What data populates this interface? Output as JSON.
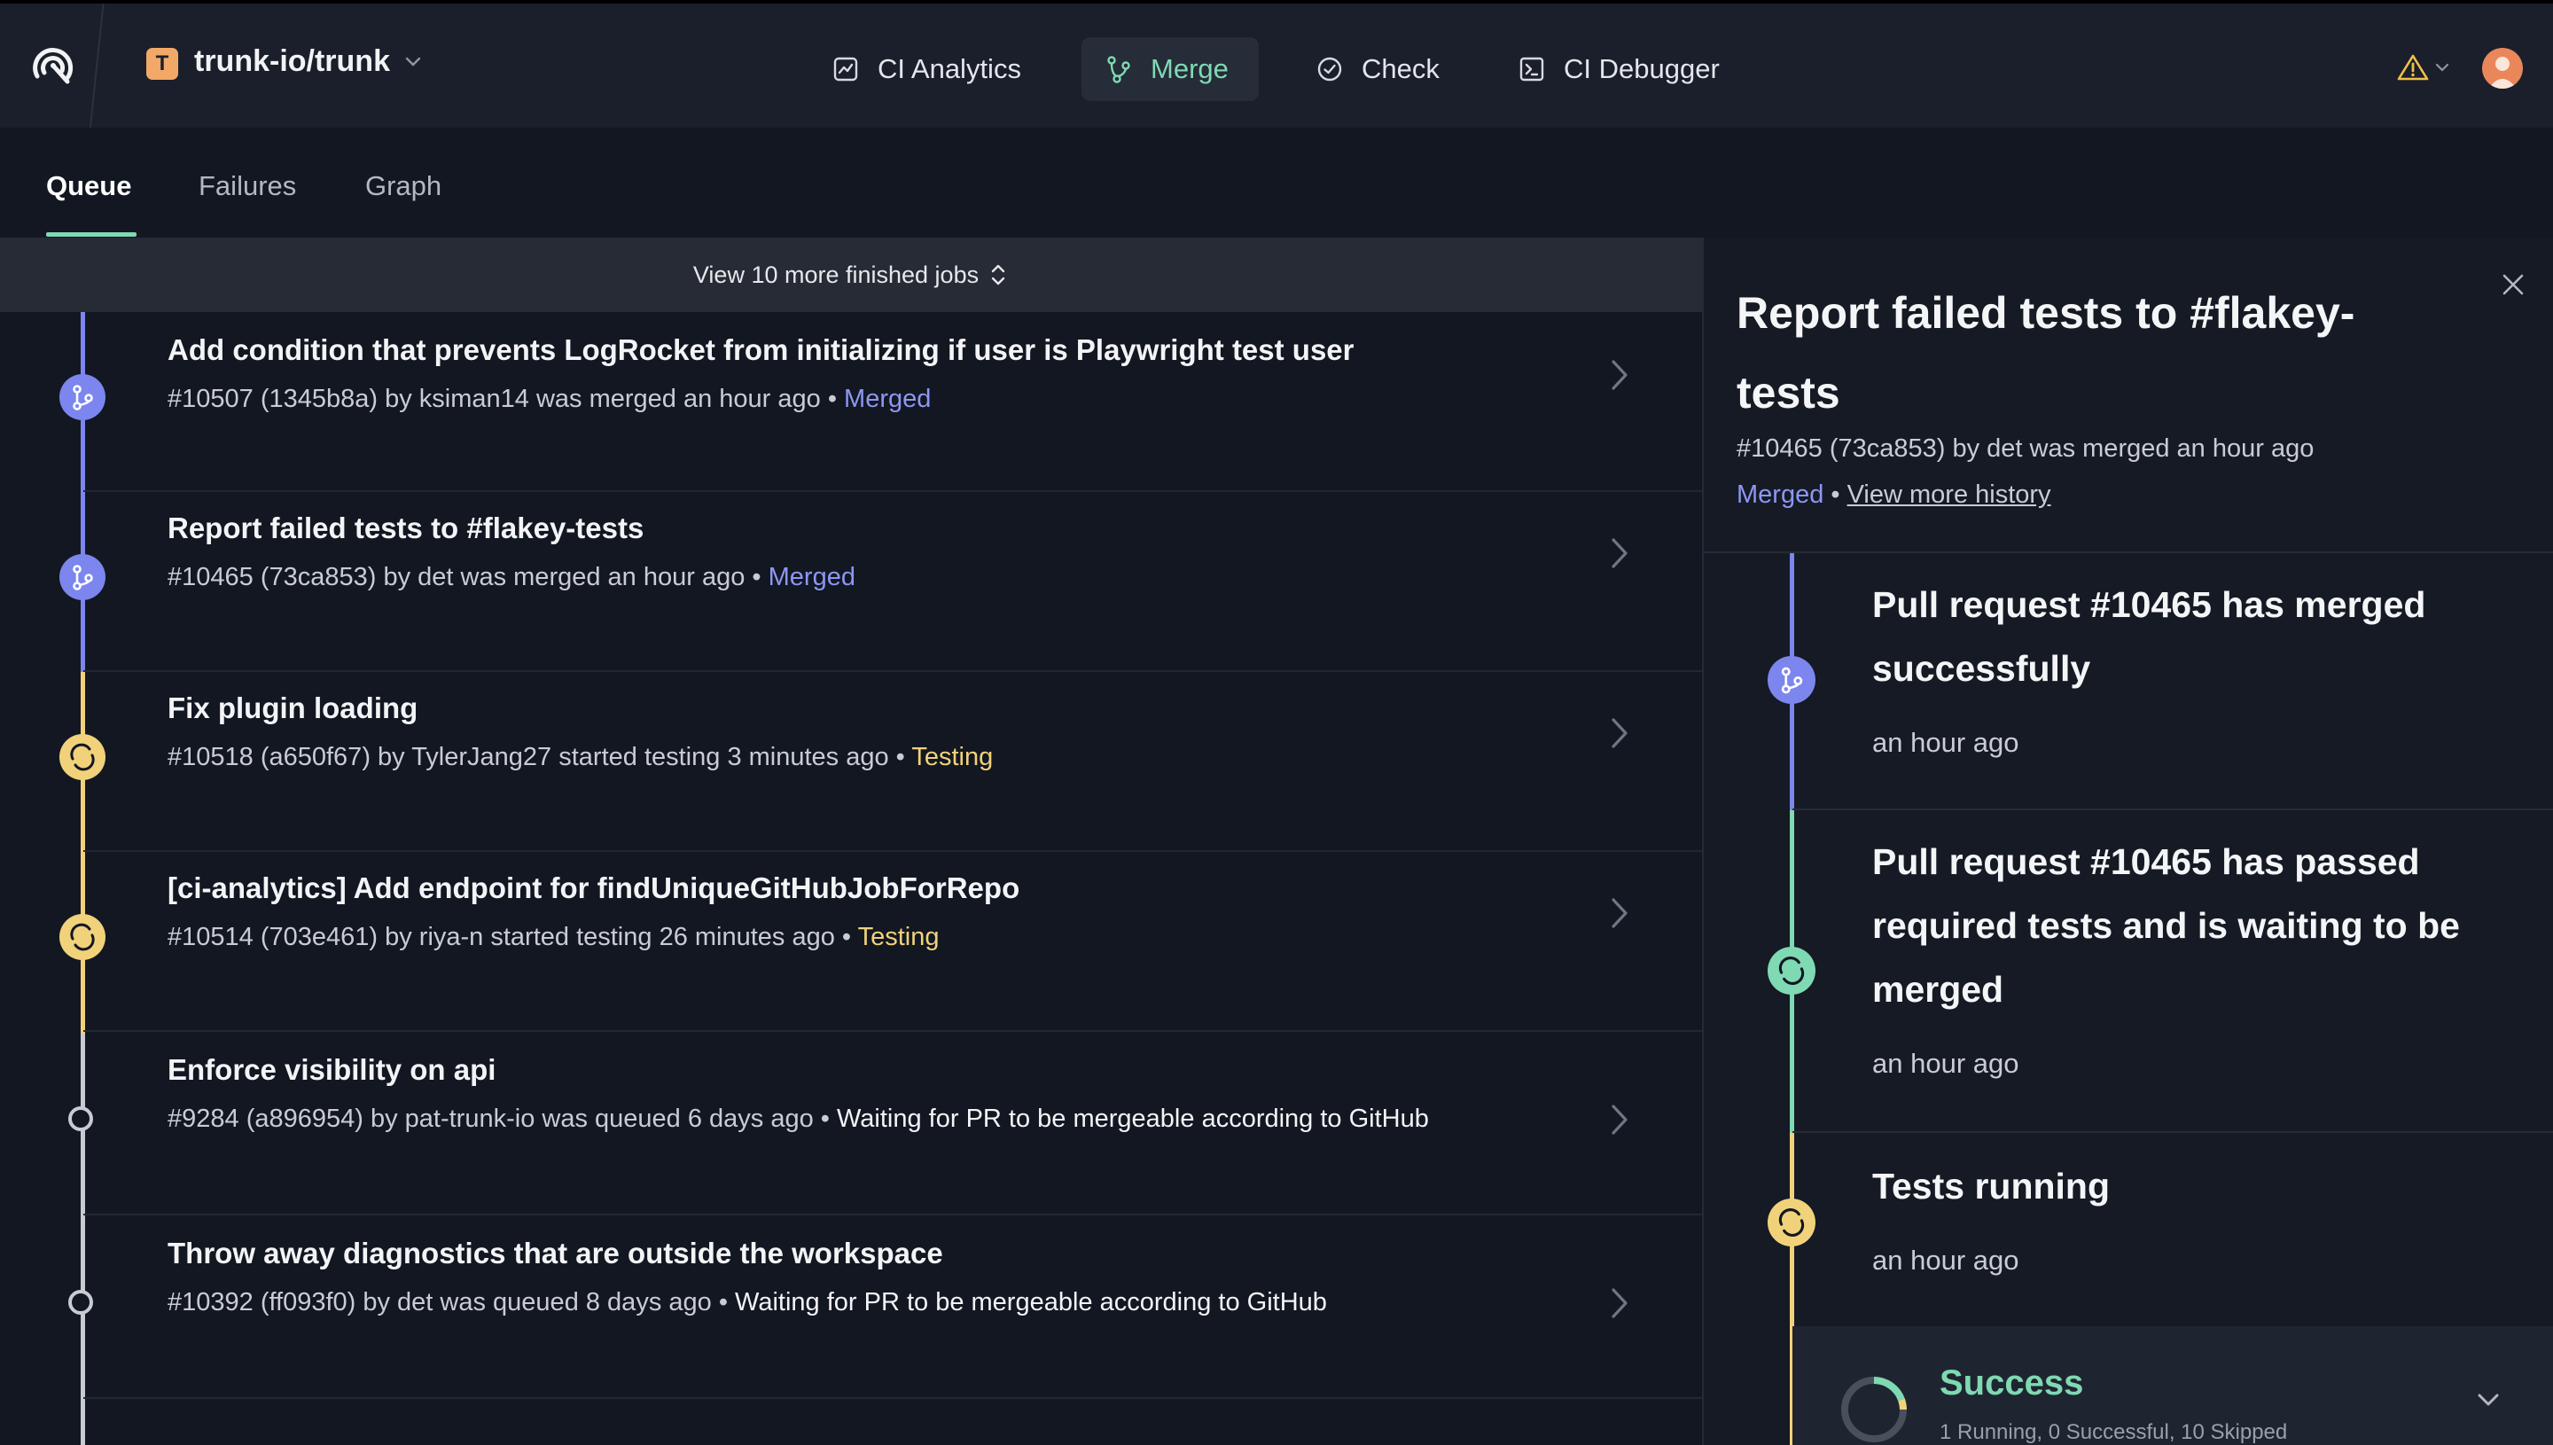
{
  "header": {
    "org_initial": "T",
    "org_name": "trunk-io/trunk",
    "nav": [
      {
        "label": "CI Analytics",
        "icon": "chart-icon"
      },
      {
        "label": "Merge",
        "icon": "merge-icon",
        "active": true
      },
      {
        "label": "Check",
        "icon": "check-circle-icon"
      },
      {
        "label": "CI Debugger",
        "icon": "terminal-icon"
      }
    ]
  },
  "tabs": [
    {
      "label": "Queue",
      "active": true
    },
    {
      "label": "Failures"
    },
    {
      "label": "Graph"
    }
  ],
  "queue": {
    "view_more": "View 10 more finished jobs",
    "rows": [
      {
        "title": "Add condition that prevents LogRocket from initializing if user is Playwright test user",
        "meta": "#10507 (1345b8a) by ksiman14 was merged an hour ago •",
        "status": "Merged",
        "state": "merged"
      },
      {
        "title": "Report failed tests to #flakey-tests",
        "meta": "#10465 (73ca853) by det was merged an hour ago •",
        "status": "Merged",
        "state": "merged"
      },
      {
        "title": "Fix plugin loading",
        "meta": "#10518 (a650f67) by TylerJang27 started testing 3 minutes ago •",
        "status": "Testing",
        "state": "testing"
      },
      {
        "title": "[ci-analytics] Add endpoint for findUniqueGitHubJobForRepo",
        "meta": "#10514 (703e461) by riya-n started testing 26 minutes ago •",
        "status": "Testing",
        "state": "testing"
      },
      {
        "title": "Enforce visibility on api",
        "meta": "#9284 (a896954) by pat-trunk-io was queued 6 days ago •",
        "status": "Waiting for PR to be mergeable according to GitHub",
        "state": "queued"
      },
      {
        "title": "Throw away diagnostics that are outside the workspace",
        "meta": "#10392 (ff093f0) by det was queued 8 days ago •",
        "status": "Waiting for PR to be mergeable according to GitHub",
        "state": "queued"
      }
    ]
  },
  "panel": {
    "title": "Report failed tests to #flakey-tests",
    "meta": "#10465 (73ca853) by det was merged an hour ago",
    "status": "Merged",
    "history_link": "View more history",
    "events": [
      {
        "title": "Pull request #10465 has merged successfully",
        "time": "an hour ago"
      },
      {
        "title": "Pull request #10465 has passed required tests and is waiting to be merged",
        "time": "an hour ago"
      },
      {
        "title": "Tests running",
        "time": "an hour ago"
      }
    ],
    "success": {
      "label": "Success",
      "sub": "1 Running, 0 Successful, 10 Skipped"
    }
  },
  "colors": {
    "merged": "#7c86ee",
    "testing": "#f1d27a",
    "passed": "#7fd9b3",
    "accent": "#7fd9b3"
  }
}
